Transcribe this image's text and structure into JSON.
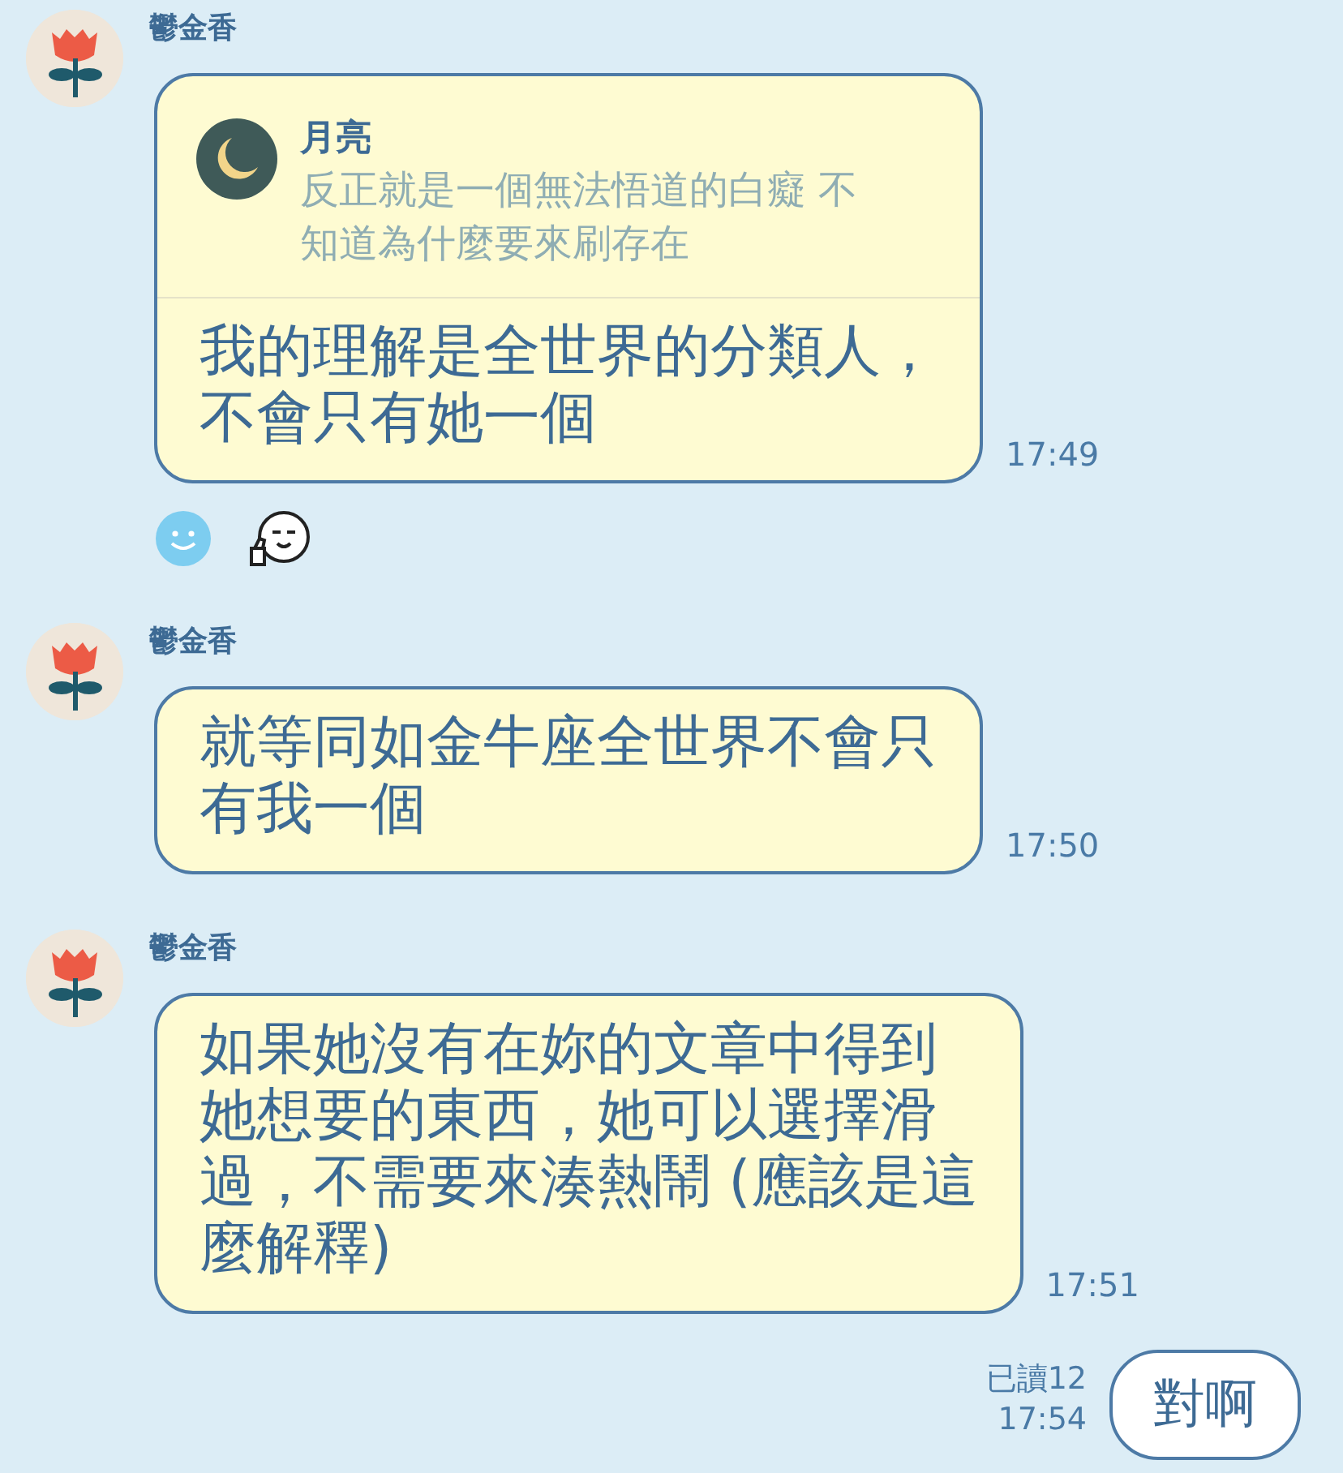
{
  "messages": [
    {
      "kind": "incoming",
      "sender": "鬱金香",
      "reply": {
        "name": "月亮",
        "lines": [
          "反正就是一個無法悟道的白癡 不",
          "知道為什麼要來刷存在"
        ]
      },
      "lines": [
        "我的理解是全世界的分類人，",
        "不會只有她一個"
      ],
      "time": "17:49",
      "reactions": [
        {
          "kind": "smiley"
        },
        {
          "kind": "thumbs-face"
        }
      ]
    },
    {
      "kind": "incoming",
      "sender": "鬱金香",
      "lines": [
        "就等同如金牛座全世界不會只",
        "有我一個"
      ],
      "time": "17:50"
    },
    {
      "kind": "incoming",
      "sender": "鬱金香",
      "lines": [
        "如果她沒有在妳的文章中得到",
        "她想要的東西，她可以選擇滑",
        "過，不需要來湊熱鬧 (應該是這",
        "麼解釋)"
      ],
      "time": "17:51"
    },
    {
      "kind": "outgoing",
      "read": "已讀12",
      "lines": [
        "對啊"
      ],
      "time": "17:54"
    }
  ]
}
